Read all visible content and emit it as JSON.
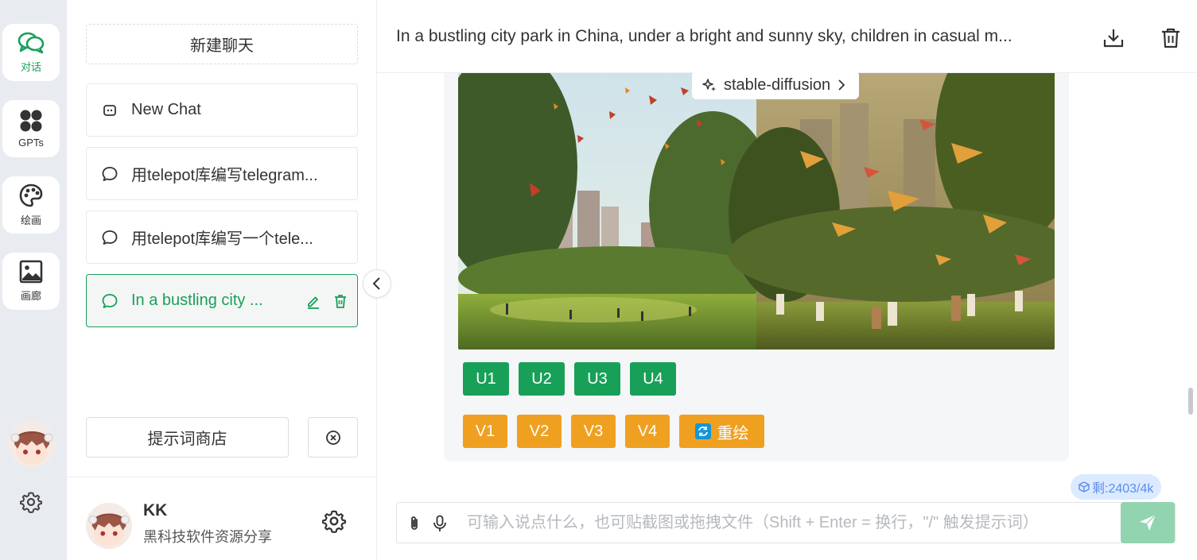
{
  "rail": {
    "items": [
      {
        "label": "对话",
        "icon": "chat-bubbles-icon",
        "active": true
      },
      {
        "label": "GPTs",
        "icon": "grid-icon",
        "active": false
      },
      {
        "label": "绘画",
        "icon": "palette-icon",
        "active": false
      },
      {
        "label": "画廊",
        "icon": "image-icon",
        "active": false
      }
    ]
  },
  "sidebar": {
    "new_chat_label": "新建聊天",
    "chats": [
      {
        "label": "New Chat",
        "icon": "robot-icon"
      },
      {
        "label": "用telepot库编写telegram...",
        "icon": "message-icon"
      },
      {
        "label": "用telepot库编写一个tele...",
        "icon": "message-icon"
      },
      {
        "label": "In a bustling city ...",
        "icon": "message-icon",
        "active": true
      }
    ],
    "prompt_store_label": "提示词商店"
  },
  "user": {
    "name": "KK",
    "description": "黑科技软件资源分享"
  },
  "header": {
    "title": "In a bustling city park in China, under a bright and sunny sky, children in casual m..."
  },
  "message": {
    "model_label": "stable-diffusion",
    "upscale_buttons": [
      "U1",
      "U2",
      "U3",
      "U4"
    ],
    "variation_buttons": [
      "V1",
      "V2",
      "V3",
      "V4"
    ],
    "redraw_label": "重绘"
  },
  "footer": {
    "token_badge": "剩:2403/4k",
    "input_placeholder": "可输入说点什么，也可贴截图或拖拽文件（Shift + Enter = 换行，\"/\" 触发提示词）",
    "input_value": ""
  },
  "colors": {
    "accent_green": "#18a058",
    "accent_orange": "#f0a020",
    "badge_blue": "#5b8def"
  }
}
